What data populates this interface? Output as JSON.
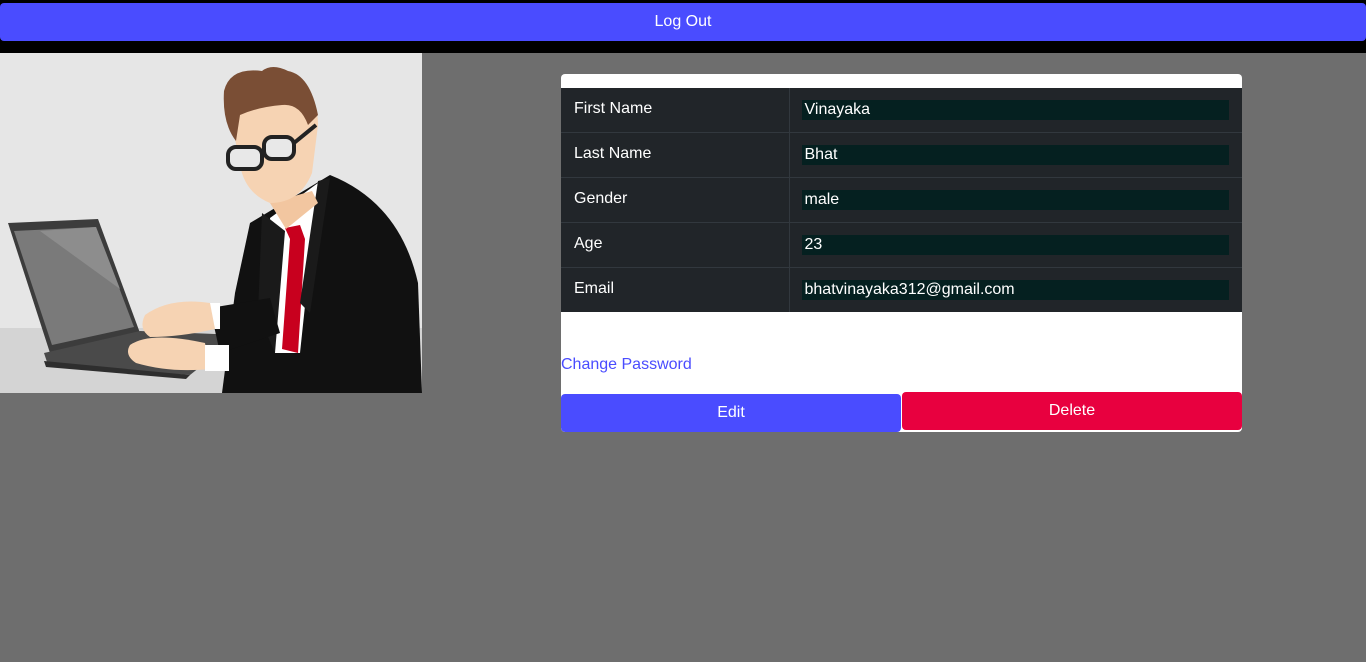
{
  "header": {
    "logout_label": "Log Out"
  },
  "profile": {
    "rows": [
      {
        "label": "First Name",
        "value": "Vinayaka"
      },
      {
        "label": "Last Name",
        "value": "Bhat"
      },
      {
        "label": "Gender",
        "value": "male"
      },
      {
        "label": "Age",
        "value": "23"
      },
      {
        "label": "Email",
        "value": "bhatvinayaka312@gmail.com"
      }
    ]
  },
  "actions": {
    "change_password_label": "Change Password",
    "edit_label": "Edit",
    "delete_label": "Delete"
  },
  "colors": {
    "accent": "#4a4cff",
    "danger": "#e8003f",
    "table_bg": "#212529",
    "page_bg": "#6e6e6e"
  },
  "illustration": {
    "icon": "man-at-laptop-illustration"
  }
}
